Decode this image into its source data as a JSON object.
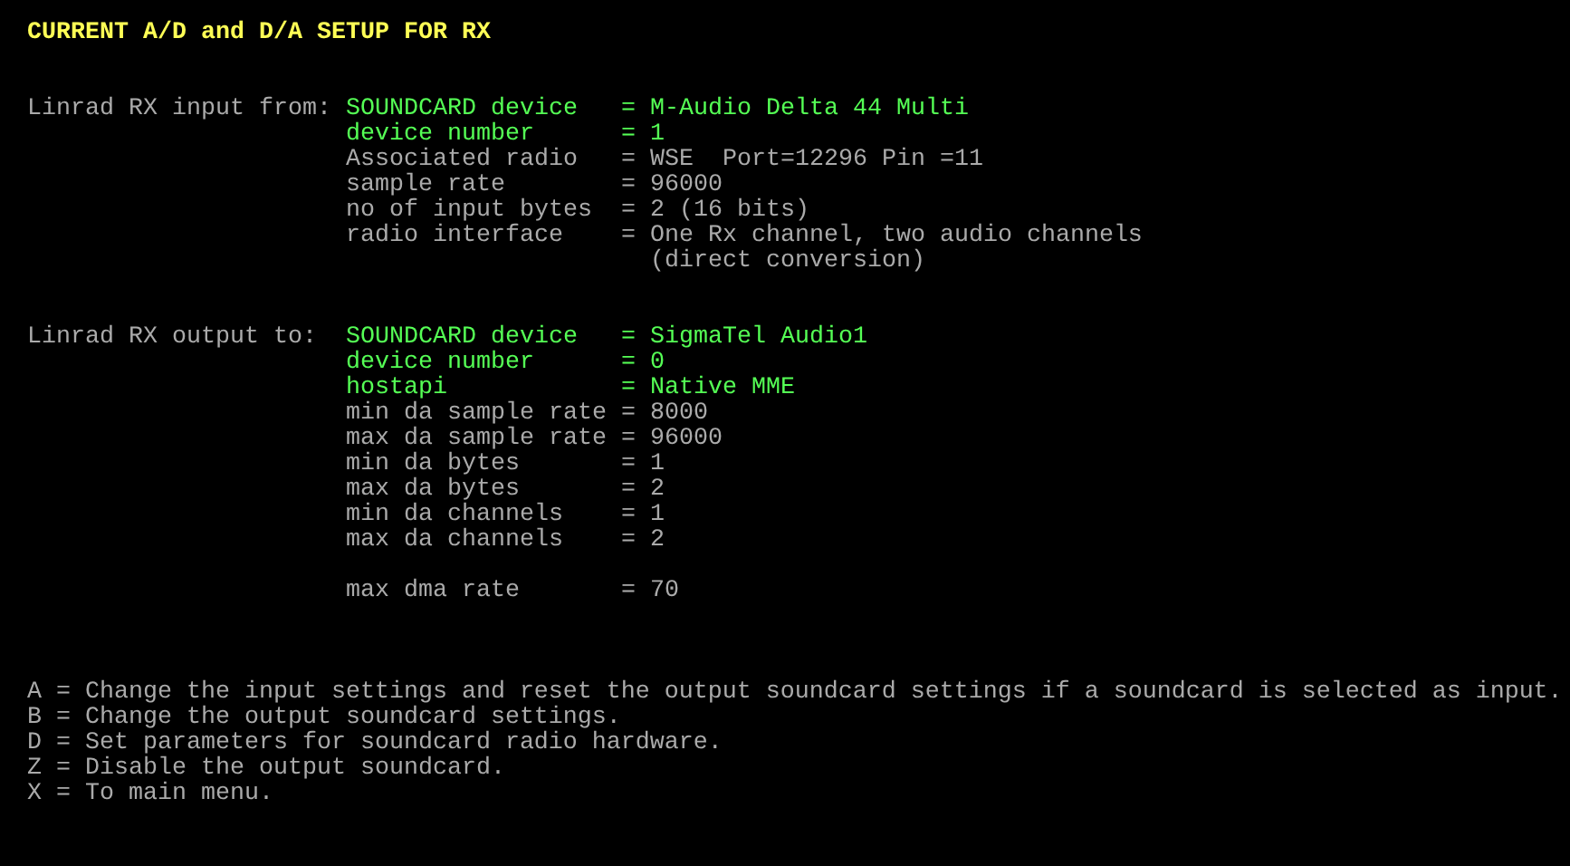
{
  "title": "CURRENT A/D and D/A SETUP FOR RX",
  "sections": [
    {
      "label": "Linrad RX input from:",
      "field_groups": [
        [
          {
            "name": "SOUNDCARD device",
            "value_lines": [
              "= M-Audio Delta 44 Multi"
            ],
            "highlighted": true
          },
          {
            "name": "device number",
            "value_lines": [
              "= 1"
            ],
            "highlighted": true
          },
          {
            "name": "Associated radio",
            "value_lines": [
              "= WSE  Port=12296 Pin =11"
            ],
            "highlighted": false
          },
          {
            "name": "sample rate",
            "value_lines": [
              "= 96000"
            ],
            "highlighted": false
          },
          {
            "name": "no of input bytes",
            "value_lines": [
              "= 2 (16 bits)"
            ],
            "highlighted": false
          },
          {
            "name": "radio interface",
            "value_lines": [
              "= One Rx channel, two audio channels",
              "  (direct conversion)"
            ],
            "highlighted": false
          }
        ]
      ]
    },
    {
      "label": "Linrad RX output to:",
      "field_groups": [
        [
          {
            "name": "SOUNDCARD device",
            "value_lines": [
              "= SigmaTel Audio1"
            ],
            "highlighted": true
          },
          {
            "name": "device number",
            "value_lines": [
              "= 0"
            ],
            "highlighted": true
          },
          {
            "name": "hostapi",
            "value_lines": [
              "= Native MME"
            ],
            "highlighted": true
          },
          {
            "name": "min da sample rate",
            "value_lines": [
              "= 8000"
            ],
            "highlighted": false
          },
          {
            "name": "max da sample rate",
            "value_lines": [
              "= 96000"
            ],
            "highlighted": false
          },
          {
            "name": "min da bytes",
            "value_lines": [
              "= 1"
            ],
            "highlighted": false
          },
          {
            "name": "max da bytes",
            "value_lines": [
              "= 2"
            ],
            "highlighted": false
          },
          {
            "name": "min da channels",
            "value_lines": [
              "= 1"
            ],
            "highlighted": false
          },
          {
            "name": "max da channels",
            "value_lines": [
              "= 2"
            ],
            "highlighted": false
          }
        ],
        [
          {
            "name": "max dma rate",
            "value_lines": [
              "= 70"
            ],
            "highlighted": false
          }
        ]
      ]
    }
  ],
  "menu": [
    "A = Change the input settings and reset the output soundcard settings if a soundcard is selected as input.",
    "B = Change the output soundcard settings.",
    "D = Set parameters for soundcard radio hardware.",
    "Z = Disable the output soundcard.",
    "X = To main menu."
  ]
}
